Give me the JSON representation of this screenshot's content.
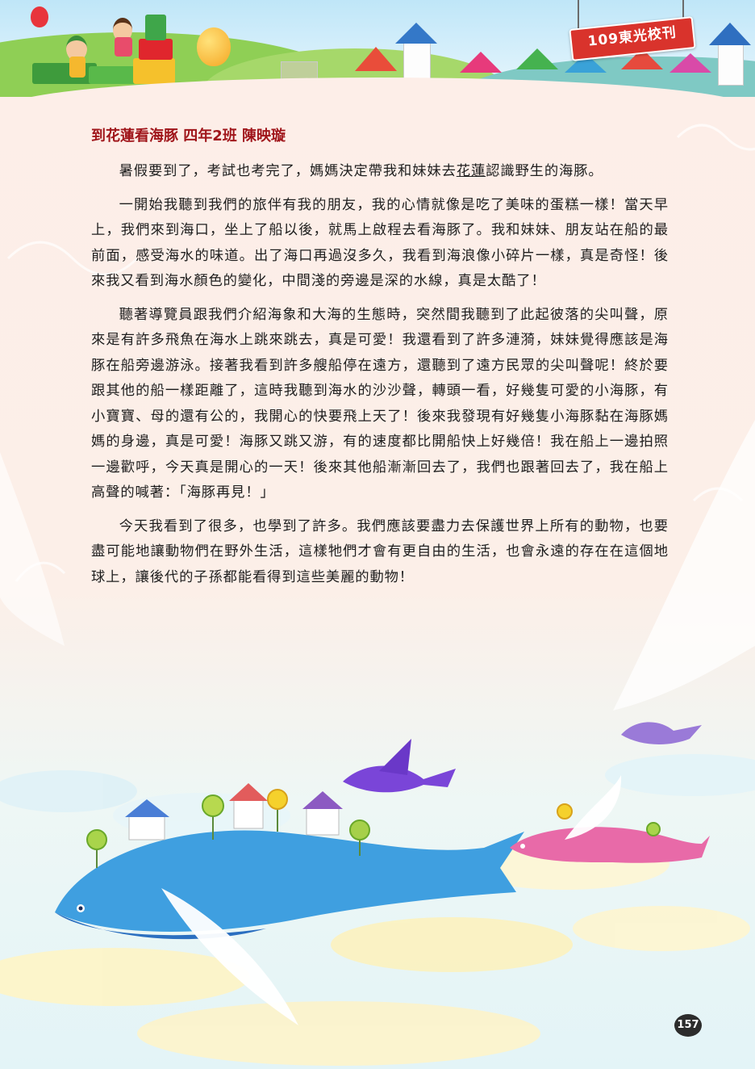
{
  "header": {
    "badge_text": "109東光校刊"
  },
  "article": {
    "title": "到花蓮看海豚 四年2班 陳映璇",
    "paragraphs": [
      {
        "before": "暑假要到了，考試也考完了，媽媽決定帶我和妹妹去",
        "underlined": "花蓮",
        "after": "認識野生的海豚。"
      },
      {
        "text": "一開始我聽到我們的旅伴有我的朋友，我的心情就像是吃了美味的蛋糕一樣！當天早上，我們來到海口，坐上了船以後，就馬上啟程去看海豚了。我和妹妹、朋友站在船的最前面，感受海水的味道。出了海口再過沒多久，我看到海浪像小碎片一樣，真是奇怪！後來我又看到海水顏色的變化，中間淺的旁邊是深的水線，真是太酷了！"
      },
      {
        "text": "聽著導覽員跟我們介紹海象和大海的生態時，突然間我聽到了此起彼落的尖叫聲，原來是有許多飛魚在海水上跳來跳去，真是可愛！我還看到了許多漣漪，妹妹覺得應該是海豚在船旁邊游泳。接著我看到許多艘船停在遠方，還聽到了遠方民眾的尖叫聲呢！終於要跟其他的船一樣距離了，這時我聽到海水的沙沙聲，轉頭一看，好幾隻可愛的小海豚，有小寶寶、母的還有公的，我開心的快要飛上天了！後來我發現有好幾隻小海豚黏在海豚媽媽的身邊，真是可愛！海豚又跳又游，有的速度都比開船快上好幾倍！我在船上一邊拍照一邊歡呼，今天真是開心的一天！後來其他船漸漸回去了，我們也跟著回去了，我在船上高聲的喊著：「海豚再見！」"
      },
      {
        "text": "今天我看到了很多，也學到了許多。我們應該要盡力去保護世界上所有的動物，也要盡可能地讓動物們在野外生活，這樣牠們才會有更自由的生活，也會永遠的存在在這個地球上，讓後代的子孫都能看得到這些美麗的動物！"
      }
    ]
  },
  "footer": {
    "page_number": "157"
  },
  "colors": {
    "title": "#a0161b",
    "badge": "#d9332c",
    "body_text": "#1e1e1e"
  }
}
